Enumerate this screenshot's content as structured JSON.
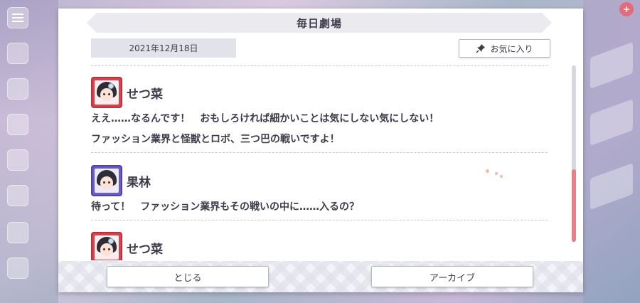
{
  "background": {
    "badge": "+"
  },
  "dialog": {
    "title": "毎日劇場",
    "date": "2021年12月18日",
    "favorite_label": "お気に入り",
    "close_label": "とじる",
    "archive_label": "アーカイブ"
  },
  "entries": [
    {
      "speaker": "せつ菜",
      "avatar_color": "#d9424c",
      "lines": [
        "ええ……なるんです！　おもしろければ細かいことは気にしない気にしない！",
        "ファッション業界と怪獣とロボ、三つ巴の戦いですよ！"
      ]
    },
    {
      "speaker": "果林",
      "avatar_color": "#6a5cc4",
      "lines": [
        "待って！　ファッション業界もその戦いの中に……入るの？"
      ]
    },
    {
      "speaker": "せつ菜",
      "avatar_color": "#d9424c",
      "lines": []
    }
  ],
  "scrollbar": {
    "position_fraction": 0.6
  },
  "colors": {
    "accent": "#e8808a",
    "text": "#3c3c4a"
  }
}
